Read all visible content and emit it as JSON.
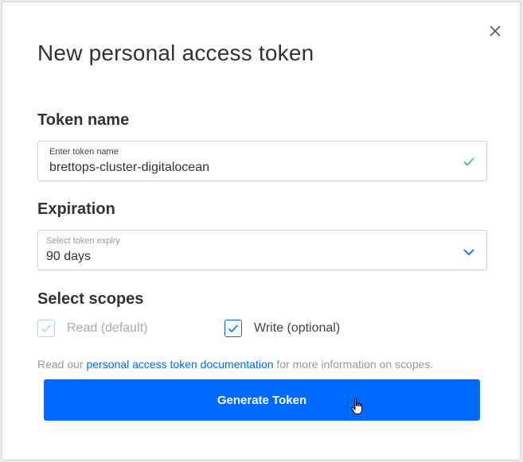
{
  "modal": {
    "title": "New personal access token",
    "close_icon": "close-icon"
  },
  "token_name": {
    "section_label": "Token name",
    "field_label": "Enter token name",
    "value": "brettops-cluster-digitalocean",
    "valid_icon": "checkmark-icon"
  },
  "expiration": {
    "section_label": "Expiration",
    "field_label": "Select token expiry",
    "value": "90 days",
    "dropdown_icon": "chevron-down-icon"
  },
  "scopes": {
    "section_label": "Select scopes",
    "items": [
      {
        "label": "Read (default)",
        "checked": true,
        "disabled": true
      },
      {
        "label": "Write (optional)",
        "checked": true,
        "disabled": false
      }
    ]
  },
  "help": {
    "prefix": "Read our ",
    "link_text": "personal access token documentation",
    "suffix": " for more information on scopes."
  },
  "actions": {
    "generate_label": "Generate Token"
  },
  "colors": {
    "accent": "#0069ff",
    "valid": "#15cd72"
  }
}
